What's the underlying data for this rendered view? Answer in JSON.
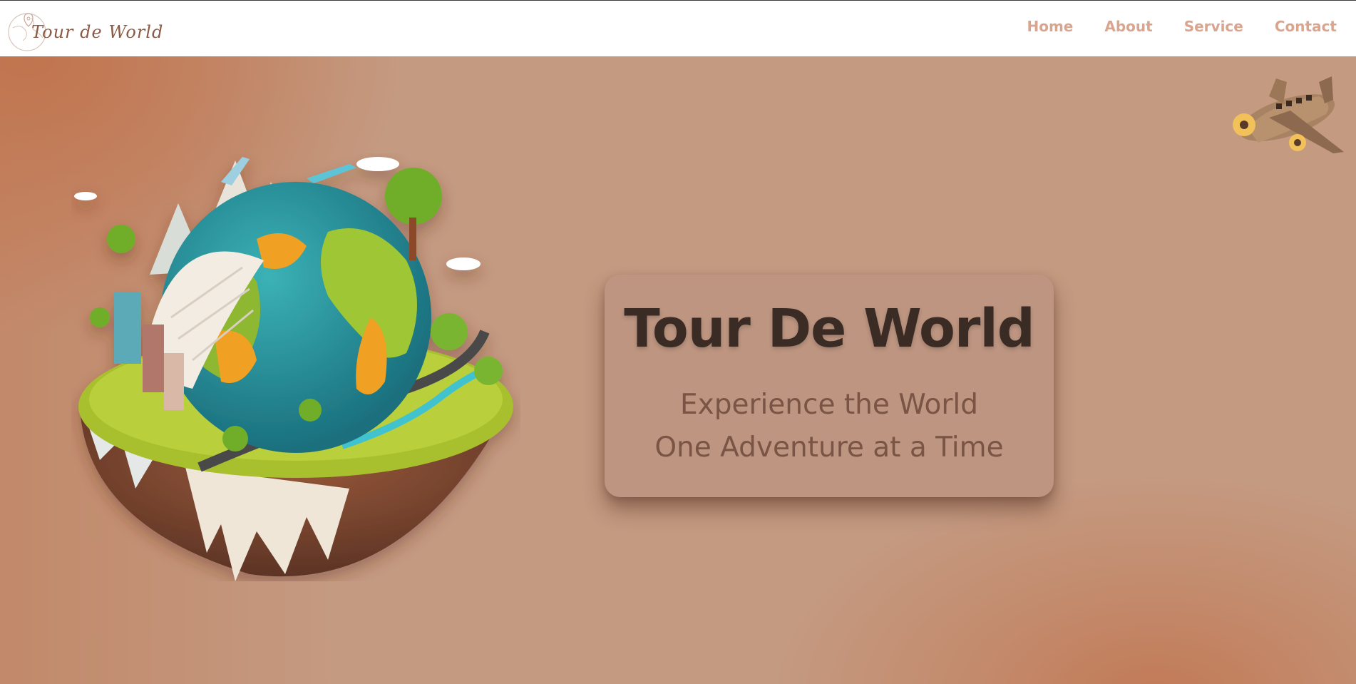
{
  "header": {
    "logo_text": "Tour de World",
    "nav": [
      "Home",
      "About",
      "Service",
      "Contact"
    ]
  },
  "hero": {
    "title": "Tour De World",
    "subtitle_line1": "Experience the World",
    "subtitle_line2": "One Adventure at a Time"
  },
  "colors": {
    "background": "#c49a81",
    "nav_text": "#d9a58e",
    "title": "#3b2b25",
    "subtitle": "#7a5444",
    "card": "#bd9581"
  }
}
